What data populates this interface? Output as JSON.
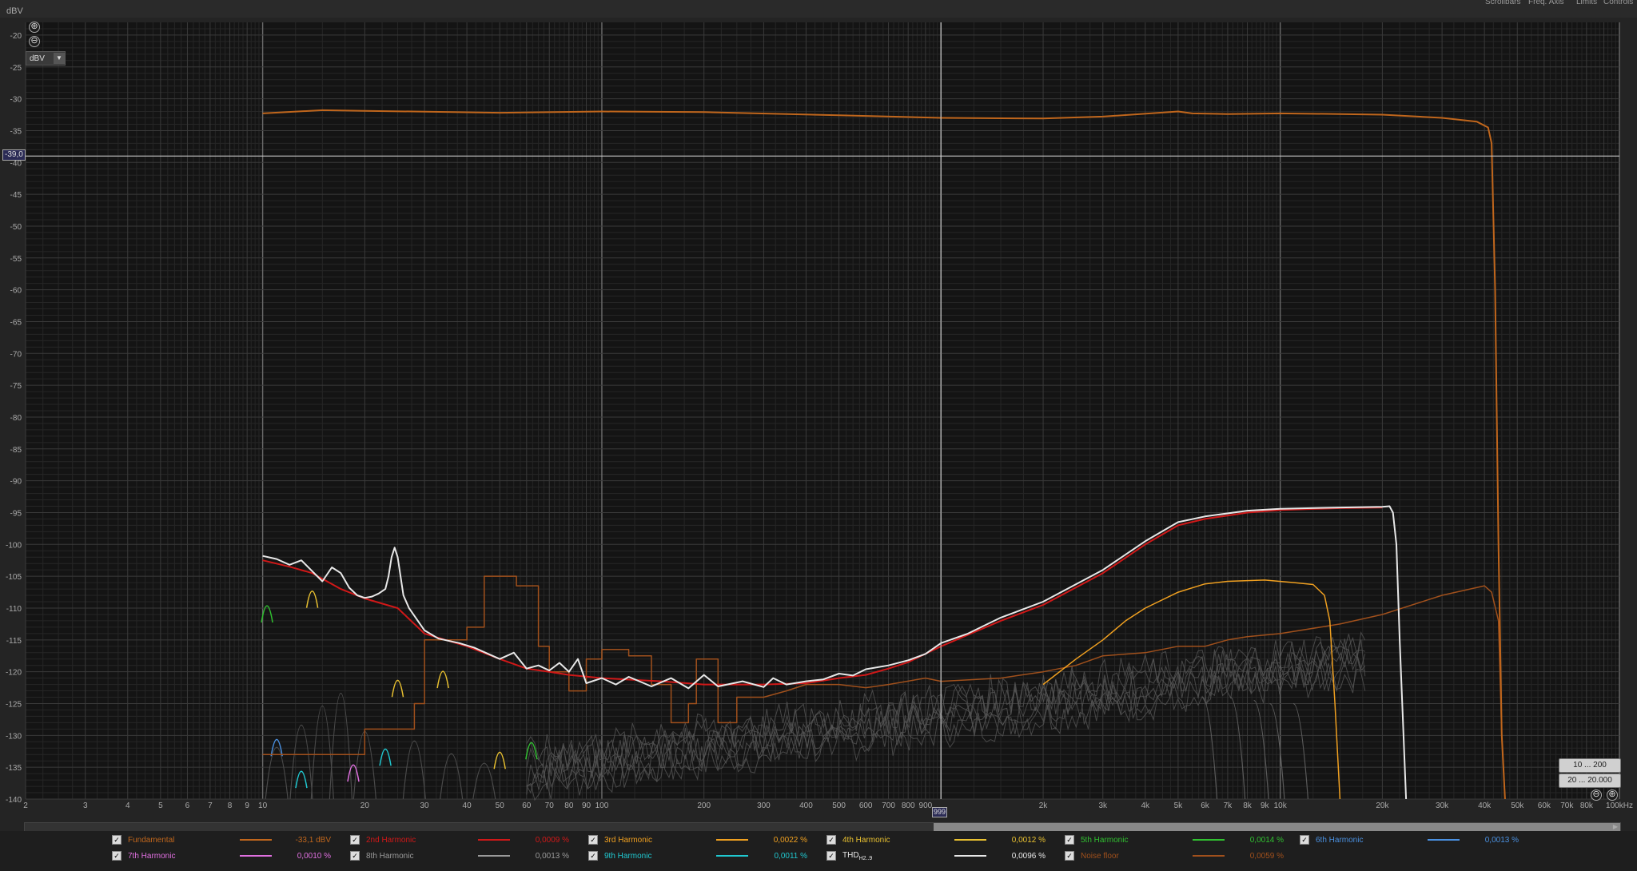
{
  "header": {
    "y_unit_label": "dBV",
    "menu": [
      "Scrollbars",
      "Freq. Axis",
      "Limits",
      "Controls"
    ]
  },
  "controls": {
    "zoom_in": "⊕",
    "zoom_out": "⊖",
    "unit_select": "dBV",
    "cursor_y_value": "-39,0",
    "cursor_x_value": "999",
    "range_button_1": "10 ... 200",
    "range_button_2": "20 ... 20.000"
  },
  "colors": {
    "background": "#141414",
    "grid_major": "#3a3a3a",
    "grid_minor": "#262626",
    "fundamental": "#c0661c",
    "h2": "#d01818",
    "h3": "#f0a020",
    "h4": "#e8c030",
    "h5": "#30c030",
    "h6": "#4a90e0",
    "h7": "#e070e0",
    "h8": "#9a9a9a",
    "h9": "#20c8d0",
    "thd": "#e8e8e8",
    "noise": "#a0501c"
  },
  "chart_data": {
    "type": "line",
    "title": "",
    "xlabel": "",
    "ylabel": "dBV",
    "xscale": "log",
    "xlim": [
      2,
      100000
    ],
    "ylim": [
      -140,
      -18
    ],
    "grid": true,
    "x_tick_labels": [
      {
        "v": 2,
        "t": "2"
      },
      {
        "v": 3,
        "t": "3"
      },
      {
        "v": 4,
        "t": "4"
      },
      {
        "v": 5,
        "t": "5"
      },
      {
        "v": 6,
        "t": "6"
      },
      {
        "v": 7,
        "t": "7"
      },
      {
        "v": 8,
        "t": "8"
      },
      {
        "v": 9,
        "t": "9"
      },
      {
        "v": 10,
        "t": "10"
      },
      {
        "v": 20,
        "t": "20"
      },
      {
        "v": 30,
        "t": "30"
      },
      {
        "v": 40,
        "t": "40"
      },
      {
        "v": 50,
        "t": "50"
      },
      {
        "v": 60,
        "t": "60"
      },
      {
        "v": 70,
        "t": "70"
      },
      {
        "v": 80,
        "t": "80"
      },
      {
        "v": 90,
        "t": "90"
      },
      {
        "v": 100,
        "t": "100"
      },
      {
        "v": 200,
        "t": "200"
      },
      {
        "v": 300,
        "t": "300"
      },
      {
        "v": 400,
        "t": "400"
      },
      {
        "v": 500,
        "t": "500"
      },
      {
        "v": 600,
        "t": "600"
      },
      {
        "v": 700,
        "t": "700"
      },
      {
        "v": 800,
        "t": "800"
      },
      {
        "v": 900,
        "t": "900"
      },
      {
        "v": 2000,
        "t": "2k"
      },
      {
        "v": 3000,
        "t": "3k"
      },
      {
        "v": 4000,
        "t": "4k"
      },
      {
        "v": 5000,
        "t": "5k"
      },
      {
        "v": 6000,
        "t": "6k"
      },
      {
        "v": 7000,
        "t": "7k"
      },
      {
        "v": 8000,
        "t": "8k"
      },
      {
        "v": 9000,
        "t": "9k"
      },
      {
        "v": 10000,
        "t": "10k"
      },
      {
        "v": 20000,
        "t": "20k"
      },
      {
        "v": 30000,
        "t": "30k"
      },
      {
        "v": 40000,
        "t": "40k"
      },
      {
        "v": 50000,
        "t": "50k"
      },
      {
        "v": 60000,
        "t": "60k"
      },
      {
        "v": 70000,
        "t": "70k"
      },
      {
        "v": 80000,
        "t": "80k"
      },
      {
        "v": 100000,
        "t": "100kHz"
      }
    ],
    "y_ticks": [
      -20,
      -25,
      -30,
      -35,
      -40,
      -45,
      -50,
      -55,
      -60,
      -65,
      -70,
      -75,
      -80,
      -85,
      -90,
      -95,
      -100,
      -105,
      -110,
      -115,
      -120,
      -125,
      -130,
      -135,
      -140
    ],
    "cursor": {
      "x": 999,
      "y": -39.0
    },
    "series": [
      {
        "name": "Fundamental",
        "color_key": "fundamental",
        "width": 2,
        "points": [
          [
            10,
            -32.3
          ],
          [
            15,
            -31.8
          ],
          [
            20,
            -31.9
          ],
          [
            50,
            -32.2
          ],
          [
            100,
            -32.0
          ],
          [
            200,
            -32.1
          ],
          [
            500,
            -32.6
          ],
          [
            1000,
            -33.0
          ],
          [
            2000,
            -33.1
          ],
          [
            3000,
            -32.8
          ],
          [
            5000,
            -32.0
          ],
          [
            5500,
            -32.3
          ],
          [
            7000,
            -32.4
          ],
          [
            10000,
            -32.3
          ],
          [
            15000,
            -32.4
          ],
          [
            20000,
            -32.5
          ],
          [
            30000,
            -33.0
          ],
          [
            38000,
            -33.6
          ],
          [
            41000,
            -34.5
          ],
          [
            42000,
            -37
          ],
          [
            43000,
            -60
          ],
          [
            44000,
            -100
          ],
          [
            45000,
            -130
          ],
          [
            46000,
            -140
          ]
        ]
      },
      {
        "name": "2nd Harmonic",
        "color_key": "h2",
        "width": 2,
        "points": [
          [
            10,
            -102.5
          ],
          [
            12,
            -103.5
          ],
          [
            14,
            -104.5
          ],
          [
            17,
            -107
          ],
          [
            20,
            -108.5
          ],
          [
            25,
            -110
          ],
          [
            30,
            -114
          ],
          [
            40,
            -116
          ],
          [
            50,
            -118
          ],
          [
            60,
            -119.5
          ],
          [
            70,
            -120
          ],
          [
            80,
            -120.5
          ],
          [
            100,
            -121
          ],
          [
            150,
            -121.5
          ],
          [
            200,
            -122
          ],
          [
            300,
            -122
          ],
          [
            400,
            -121.8
          ],
          [
            500,
            -121
          ],
          [
            600,
            -120.5
          ],
          [
            700,
            -119.5
          ],
          [
            800,
            -118.5
          ],
          [
            1000,
            -116
          ],
          [
            1500,
            -112
          ],
          [
            2000,
            -109.5
          ],
          [
            3000,
            -104.5
          ],
          [
            4000,
            -100
          ],
          [
            5000,
            -97
          ],
          [
            6000,
            -96
          ],
          [
            8000,
            -95
          ],
          [
            10000,
            -94.6
          ],
          [
            15000,
            -94.3
          ],
          [
            20000,
            -94.2
          ]
        ]
      },
      {
        "name": "3rd Harmonic",
        "color_key": "h3",
        "width": 1.5,
        "points": [
          [
            2000,
            -122
          ],
          [
            2500,
            -118
          ],
          [
            3000,
            -115
          ],
          [
            3500,
            -112
          ],
          [
            4000,
            -110
          ],
          [
            5000,
            -107.5
          ],
          [
            6000,
            -106.2
          ],
          [
            7000,
            -105.8
          ],
          [
            9000,
            -105.6
          ],
          [
            11000,
            -106
          ],
          [
            12500,
            -106.3
          ],
          [
            13500,
            -108
          ],
          [
            14000,
            -112
          ],
          [
            14500,
            -125
          ],
          [
            15000,
            -140
          ]
        ]
      },
      {
        "name": "THD",
        "color_key": "thd",
        "width": 2,
        "points": [
          [
            10,
            -101.8
          ],
          [
            11,
            -102.3
          ],
          [
            12,
            -103.2
          ],
          [
            13,
            -102.5
          ],
          [
            14,
            -104.2
          ],
          [
            15,
            -105.8
          ],
          [
            16,
            -103.6
          ],
          [
            17,
            -104.5
          ],
          [
            18,
            -106.8
          ],
          [
            19,
            -108
          ],
          [
            20,
            -108.4
          ],
          [
            21,
            -108.2
          ],
          [
            22,
            -107.7
          ],
          [
            23,
            -107
          ],
          [
            23.5,
            -105
          ],
          [
            24,
            -102
          ],
          [
            24.5,
            -100.5
          ],
          [
            25,
            -102
          ],
          [
            26,
            -108
          ],
          [
            27,
            -110
          ],
          [
            30,
            -113.5
          ],
          [
            33,
            -114.8
          ],
          [
            38,
            -115.5
          ],
          [
            42,
            -116.2
          ],
          [
            50,
            -118
          ],
          [
            55,
            -117
          ],
          [
            60,
            -119.5
          ],
          [
            65,
            -119
          ],
          [
            70,
            -119.8
          ],
          [
            75,
            -118.6
          ],
          [
            80,
            -120
          ],
          [
            85,
            -118
          ],
          [
            90,
            -121.8
          ],
          [
            100,
            -121
          ],
          [
            110,
            -122
          ],
          [
            120,
            -120.8
          ],
          [
            140,
            -122.3
          ],
          [
            160,
            -121
          ],
          [
            180,
            -122.6
          ],
          [
            200,
            -120.5
          ],
          [
            220,
            -122.3
          ],
          [
            260,
            -121.5
          ],
          [
            300,
            -122.4
          ],
          [
            320,
            -121
          ],
          [
            350,
            -122
          ],
          [
            400,
            -121.5
          ],
          [
            450,
            -121.2
          ],
          [
            500,
            -120.3
          ],
          [
            550,
            -120.6
          ],
          [
            600,
            -119.6
          ],
          [
            700,
            -119
          ],
          [
            800,
            -118.2
          ],
          [
            900,
            -117.2
          ],
          [
            1000,
            -115.5
          ],
          [
            1200,
            -114
          ],
          [
            1500,
            -111.5
          ],
          [
            2000,
            -109
          ],
          [
            3000,
            -104
          ],
          [
            4000,
            -99.5
          ],
          [
            5000,
            -96.5
          ],
          [
            6000,
            -95.6
          ],
          [
            8000,
            -94.7
          ],
          [
            10000,
            -94.4
          ],
          [
            15000,
            -94.2
          ],
          [
            20000,
            -94.1
          ],
          [
            21000,
            -94
          ],
          [
            21500,
            -95
          ],
          [
            22000,
            -100
          ],
          [
            22500,
            -115
          ],
          [
            23500,
            -140
          ]
        ]
      },
      {
        "name": "Noise floor",
        "color_key": "noise",
        "width": 1.5,
        "points": [
          [
            10,
            -133
          ],
          [
            20,
            -133
          ],
          [
            20,
            -129
          ],
          [
            28,
            -129
          ],
          [
            28,
            -125
          ],
          [
            30,
            -125
          ],
          [
            30,
            -115
          ],
          [
            40,
            -115
          ],
          [
            40,
            -113
          ],
          [
            45,
            -113
          ],
          [
            45,
            -105
          ],
          [
            56,
            -105
          ],
          [
            56,
            -106.5
          ],
          [
            65,
            -106.5
          ],
          [
            65,
            -116
          ],
          [
            70,
            -116
          ],
          [
            70,
            -120
          ],
          [
            80,
            -120
          ],
          [
            80,
            -123
          ],
          [
            90,
            -123
          ],
          [
            90,
            -118
          ],
          [
            100,
            -118
          ],
          [
            100,
            -116.5
          ],
          [
            120,
            -116.5
          ],
          [
            120,
            -117.5
          ],
          [
            140,
            -117.5
          ],
          [
            140,
            -122
          ],
          [
            160,
            -122
          ],
          [
            160,
            -128
          ],
          [
            180,
            -128
          ],
          [
            180,
            -125
          ],
          [
            190,
            -125
          ],
          [
            190,
            -118
          ],
          [
            220,
            -118
          ],
          [
            220,
            -128
          ],
          [
            250,
            -128
          ],
          [
            250,
            -124
          ],
          [
            300,
            -124
          ],
          [
            350,
            -123
          ],
          [
            400,
            -122
          ],
          [
            500,
            -122
          ],
          [
            600,
            -122.5
          ],
          [
            700,
            -122
          ],
          [
            900,
            -121
          ],
          [
            1000,
            -121.5
          ],
          [
            1500,
            -121
          ],
          [
            2000,
            -120
          ],
          [
            2500,
            -119
          ],
          [
            3000,
            -117.5
          ],
          [
            4000,
            -117
          ],
          [
            5000,
            -116
          ],
          [
            6000,
            -116
          ],
          [
            7000,
            -115
          ],
          [
            8000,
            -114.5
          ],
          [
            10000,
            -114
          ],
          [
            15000,
            -112.5
          ],
          [
            20000,
            -111
          ],
          [
            30000,
            -108
          ],
          [
            40000,
            -106.5
          ],
          [
            42000,
            -107.5
          ],
          [
            44000,
            -112
          ],
          [
            45000,
            -130
          ],
          [
            46000,
            -140
          ]
        ]
      },
      {
        "name": "4th Harmonic",
        "color_key": "h4",
        "width": 1.5,
        "bumps": [
          [
            14,
            -107.2
          ],
          [
            25,
            -121.2
          ],
          [
            34,
            -119.8
          ],
          [
            50,
            -132.5
          ]
        ]
      },
      {
        "name": "5th Harmonic",
        "color_key": "h5",
        "width": 1.5,
        "bumps": [
          [
            10.3,
            -109.5
          ],
          [
            62,
            -131
          ]
        ]
      },
      {
        "name": "6th Harmonic",
        "color_key": "h6",
        "width": 1.5,
        "bumps": [
          [
            11,
            -130.5
          ]
        ]
      },
      {
        "name": "7th Harmonic",
        "color_key": "h7",
        "width": 1.5,
        "bumps": [
          [
            18.5,
            -134.5
          ]
        ]
      },
      {
        "name": "9th Harmonic",
        "color_key": "h9",
        "width": 1.5,
        "bumps": [
          [
            13,
            -135.5
          ],
          [
            23,
            -132
          ]
        ]
      }
    ]
  },
  "legend": [
    {
      "label": "Fundamental",
      "color_key": "fundamental",
      "value": "-33,1 dBV",
      "checked": true
    },
    {
      "label": "2nd Harmonic",
      "color_key": "h2",
      "value": "0,0009 %",
      "checked": true
    },
    {
      "label": "3rd Harmonic",
      "color_key": "h3",
      "value": "0,0022 %",
      "checked": true
    },
    {
      "label": "4th Harmonic",
      "color_key": "h4",
      "value": "0,0012 %",
      "checked": true
    },
    {
      "label": "5th Harmonic",
      "color_key": "h5",
      "value": "0,0014 %",
      "checked": true
    },
    {
      "label": "6th Harmonic",
      "color_key": "h6",
      "value": "0,0013 %",
      "checked": true
    },
    {
      "label": "7th Harmonic",
      "color_key": "h7",
      "value": "0,0010 %",
      "checked": true
    },
    {
      "label": "8th Harmonic",
      "color_key": "h8",
      "value": "0,0013 %",
      "checked": true
    },
    {
      "label": "9th Harmonic",
      "color_key": "h9",
      "value": "0,0011 %",
      "checked": true
    },
    {
      "label": "THD",
      "sub": "H2..9",
      "color_key": "thd",
      "value": "0,0096 %",
      "checked": true
    },
    {
      "label": "Noise floor",
      "color_key": "noise",
      "value": "0,0059 %",
      "checked": true
    }
  ]
}
